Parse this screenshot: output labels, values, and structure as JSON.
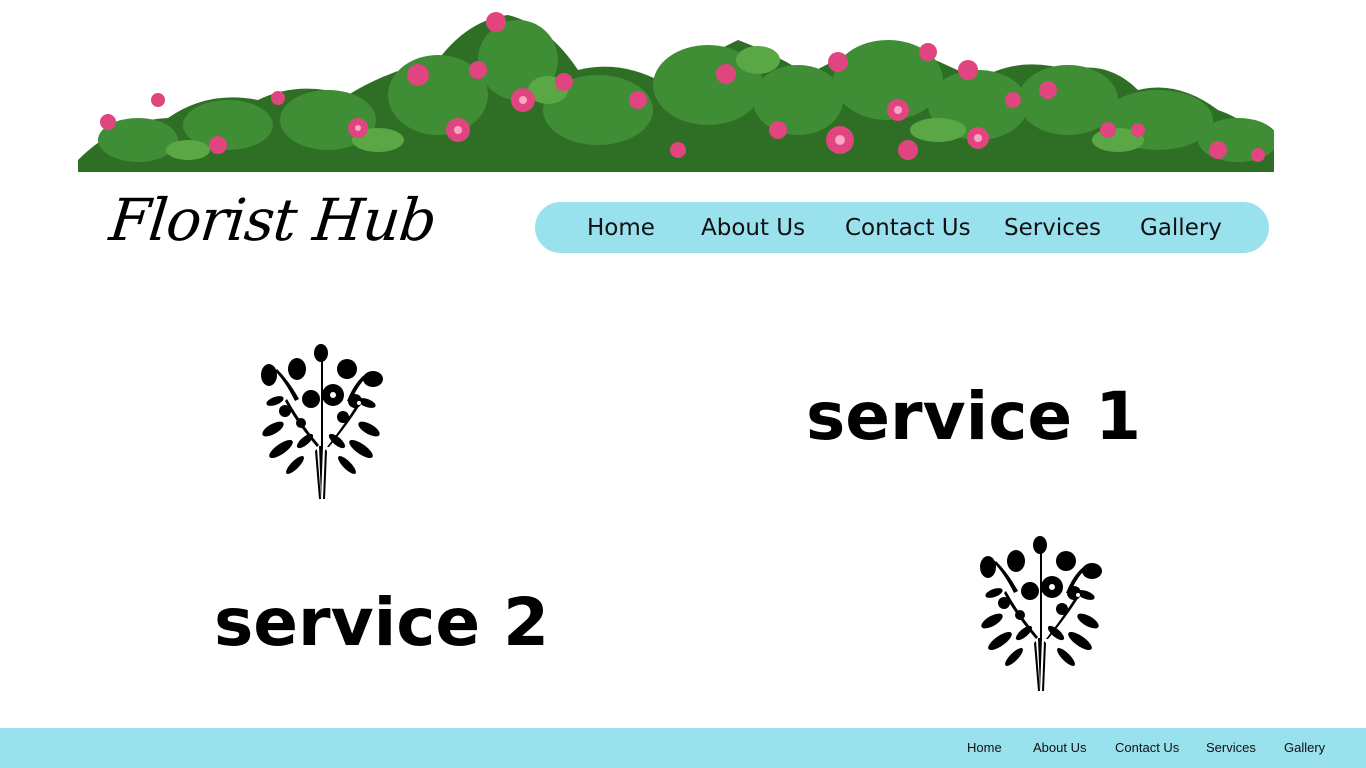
{
  "brand": {
    "logo_text": "Florist Hub"
  },
  "nav": {
    "items": [
      {
        "label": "Home"
      },
      {
        "label": "About Us"
      },
      {
        "label": "Contact Us"
      },
      {
        "label": "Services"
      },
      {
        "label": "Gallery"
      }
    ]
  },
  "services": [
    {
      "title": "service 1",
      "icon": "flower-bouquet-icon"
    },
    {
      "title": "service 2",
      "icon": "flower-bouquet-icon"
    }
  ],
  "footer": {
    "items": [
      {
        "label": "Home"
      },
      {
        "label": "About Us"
      },
      {
        "label": "Contact Us"
      },
      {
        "label": "Services"
      },
      {
        "label": "Gallery"
      }
    ]
  },
  "colors": {
    "nav_background": "#9ae1ee",
    "footer_background": "#98e1ed",
    "flower_pink": "#e0457f",
    "leaf_green": "#2f7a2a"
  }
}
